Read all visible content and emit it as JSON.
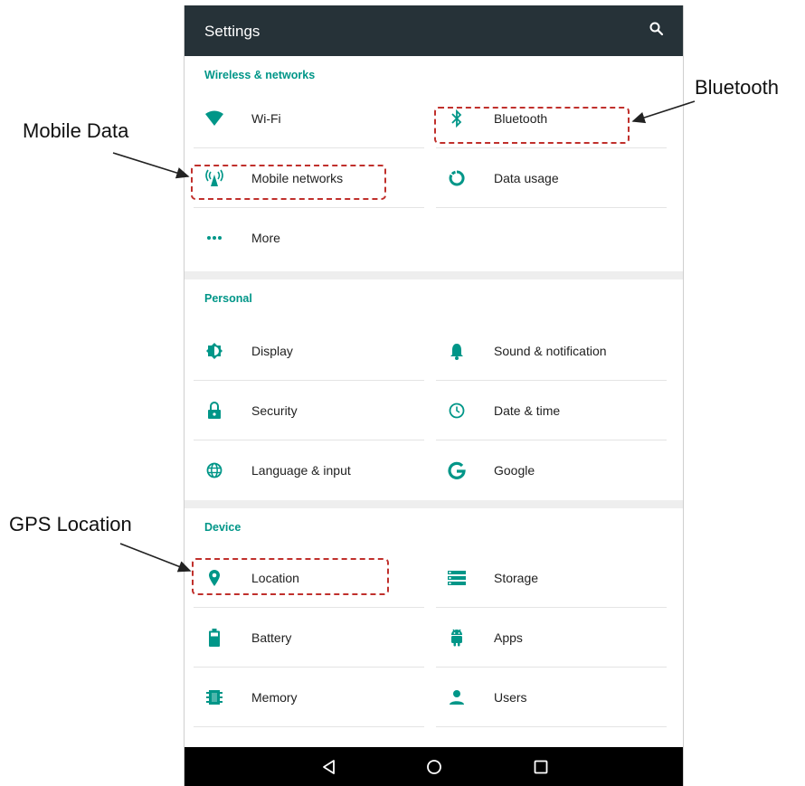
{
  "appbar": {
    "title": "Settings",
    "search_icon": "search-icon"
  },
  "colors": {
    "accent": "#009688",
    "appbar": "#263238",
    "annotation_box": "#c0302c"
  },
  "sections": {
    "wireless": {
      "header": "Wireless & networks",
      "items": [
        {
          "label": "Wi-Fi",
          "icon": "wifi-icon"
        },
        {
          "label": "Bluetooth",
          "icon": "bluetooth-icon"
        },
        {
          "label": "Mobile networks",
          "icon": "cell-tower-icon"
        },
        {
          "label": "Data usage",
          "icon": "data-usage-icon"
        },
        {
          "label": "More",
          "icon": "more-dots-icon"
        }
      ]
    },
    "personal": {
      "header": "Personal",
      "items": [
        {
          "label": "Display",
          "icon": "brightness-icon"
        },
        {
          "label": "Sound & notification",
          "icon": "bell-icon"
        },
        {
          "label": "Security",
          "icon": "lock-icon"
        },
        {
          "label": "Date & time",
          "icon": "clock-icon"
        },
        {
          "label": "Language & input",
          "icon": "globe-icon"
        },
        {
          "label": "Google",
          "icon": "google-g-icon"
        }
      ]
    },
    "device": {
      "header": "Device",
      "items": [
        {
          "label": "Location",
          "icon": "location-pin-icon"
        },
        {
          "label": "Storage",
          "icon": "storage-icon"
        },
        {
          "label": "Battery",
          "icon": "battery-icon"
        },
        {
          "label": "Apps",
          "icon": "android-icon"
        },
        {
          "label": "Memory",
          "icon": "memory-chip-icon"
        },
        {
          "label": "Users",
          "icon": "person-icon"
        }
      ]
    }
  },
  "navbar": {
    "back_icon": "back-triangle-icon",
    "home_icon": "home-circle-icon",
    "recents_icon": "recents-square-icon"
  },
  "annotations": {
    "bluetooth": "Bluetooth",
    "mobile_data": "Mobile Data",
    "gps_location": "GPS Location"
  }
}
